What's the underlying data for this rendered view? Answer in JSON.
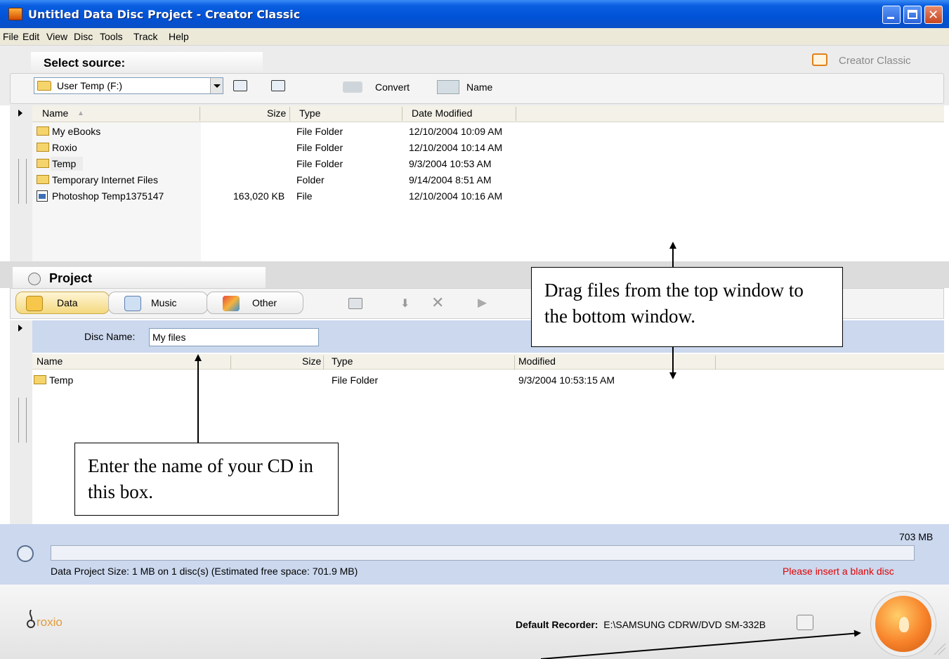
{
  "window": {
    "title": "Untitled Data Disc Project - Creator Classic"
  },
  "menu": [
    "File",
    "Edit",
    "View",
    "Disc",
    "Tools",
    "Track",
    "Help"
  ],
  "source": {
    "heading": "Select source:",
    "brand": "Creator Classic",
    "drive": "User Temp (F:)",
    "convert_label": "Convert",
    "name_label": "Name",
    "columns": [
      "Name",
      "Size",
      "Type",
      "Date Modified"
    ],
    "rows": [
      {
        "name": "My eBooks",
        "size": "",
        "type": "File Folder",
        "date": "12/10/2004 10:09 AM",
        "icon": "folder-icon"
      },
      {
        "name": "Roxio",
        "size": "",
        "type": "File Folder",
        "date": "12/10/2004 10:14 AM",
        "icon": "folder-icon"
      },
      {
        "name": "Temp",
        "size": "",
        "type": "File Folder",
        "date": "9/3/2004 10:53 AM",
        "icon": "folder-icon"
      },
      {
        "name": "Temporary Internet Files",
        "size": "",
        "type": "Folder",
        "date": "9/14/2004 8:51 AM",
        "icon": "folder-icon"
      },
      {
        "name": "Photoshop Temp1375147",
        "size": "163,020 KB",
        "type": "File",
        "date": "12/10/2004 10:16 AM",
        "icon": "file-icon"
      }
    ]
  },
  "project": {
    "heading": "Project",
    "tabs": [
      "Data",
      "Music",
      "Other"
    ],
    "disc_name_label": "Disc Name:",
    "disc_name_value": "My files",
    "columns": [
      "Name",
      "Size",
      "Type",
      "Modified"
    ],
    "rows": [
      {
        "name": "Temp",
        "size": "",
        "type": "File Folder",
        "modified": "9/3/2004 10:53:15 AM",
        "icon": "folder-icon"
      }
    ]
  },
  "status": {
    "capacity": "703 MB",
    "project_size": "Data Project Size: 1 MB  on 1 disc(s)  (Estimated free space: 701.9 MB)",
    "message": "Please insert a blank disc",
    "progress_fraction": 0.0
  },
  "footer": {
    "logo": "roxio",
    "recorder_label": "Default Recorder:",
    "recorder_value": "E:\\SAMSUNG CDRW/DVD SM-332B"
  },
  "callouts": {
    "drag": "Drag files from the top window to the bottom window.",
    "disc_name": "Enter the name of your CD in this box."
  },
  "colors": {
    "title_bar": "#0052d6",
    "accent_orange": "#f8822a",
    "status_band": "#cbd8ee",
    "error_text": "#e00000"
  }
}
